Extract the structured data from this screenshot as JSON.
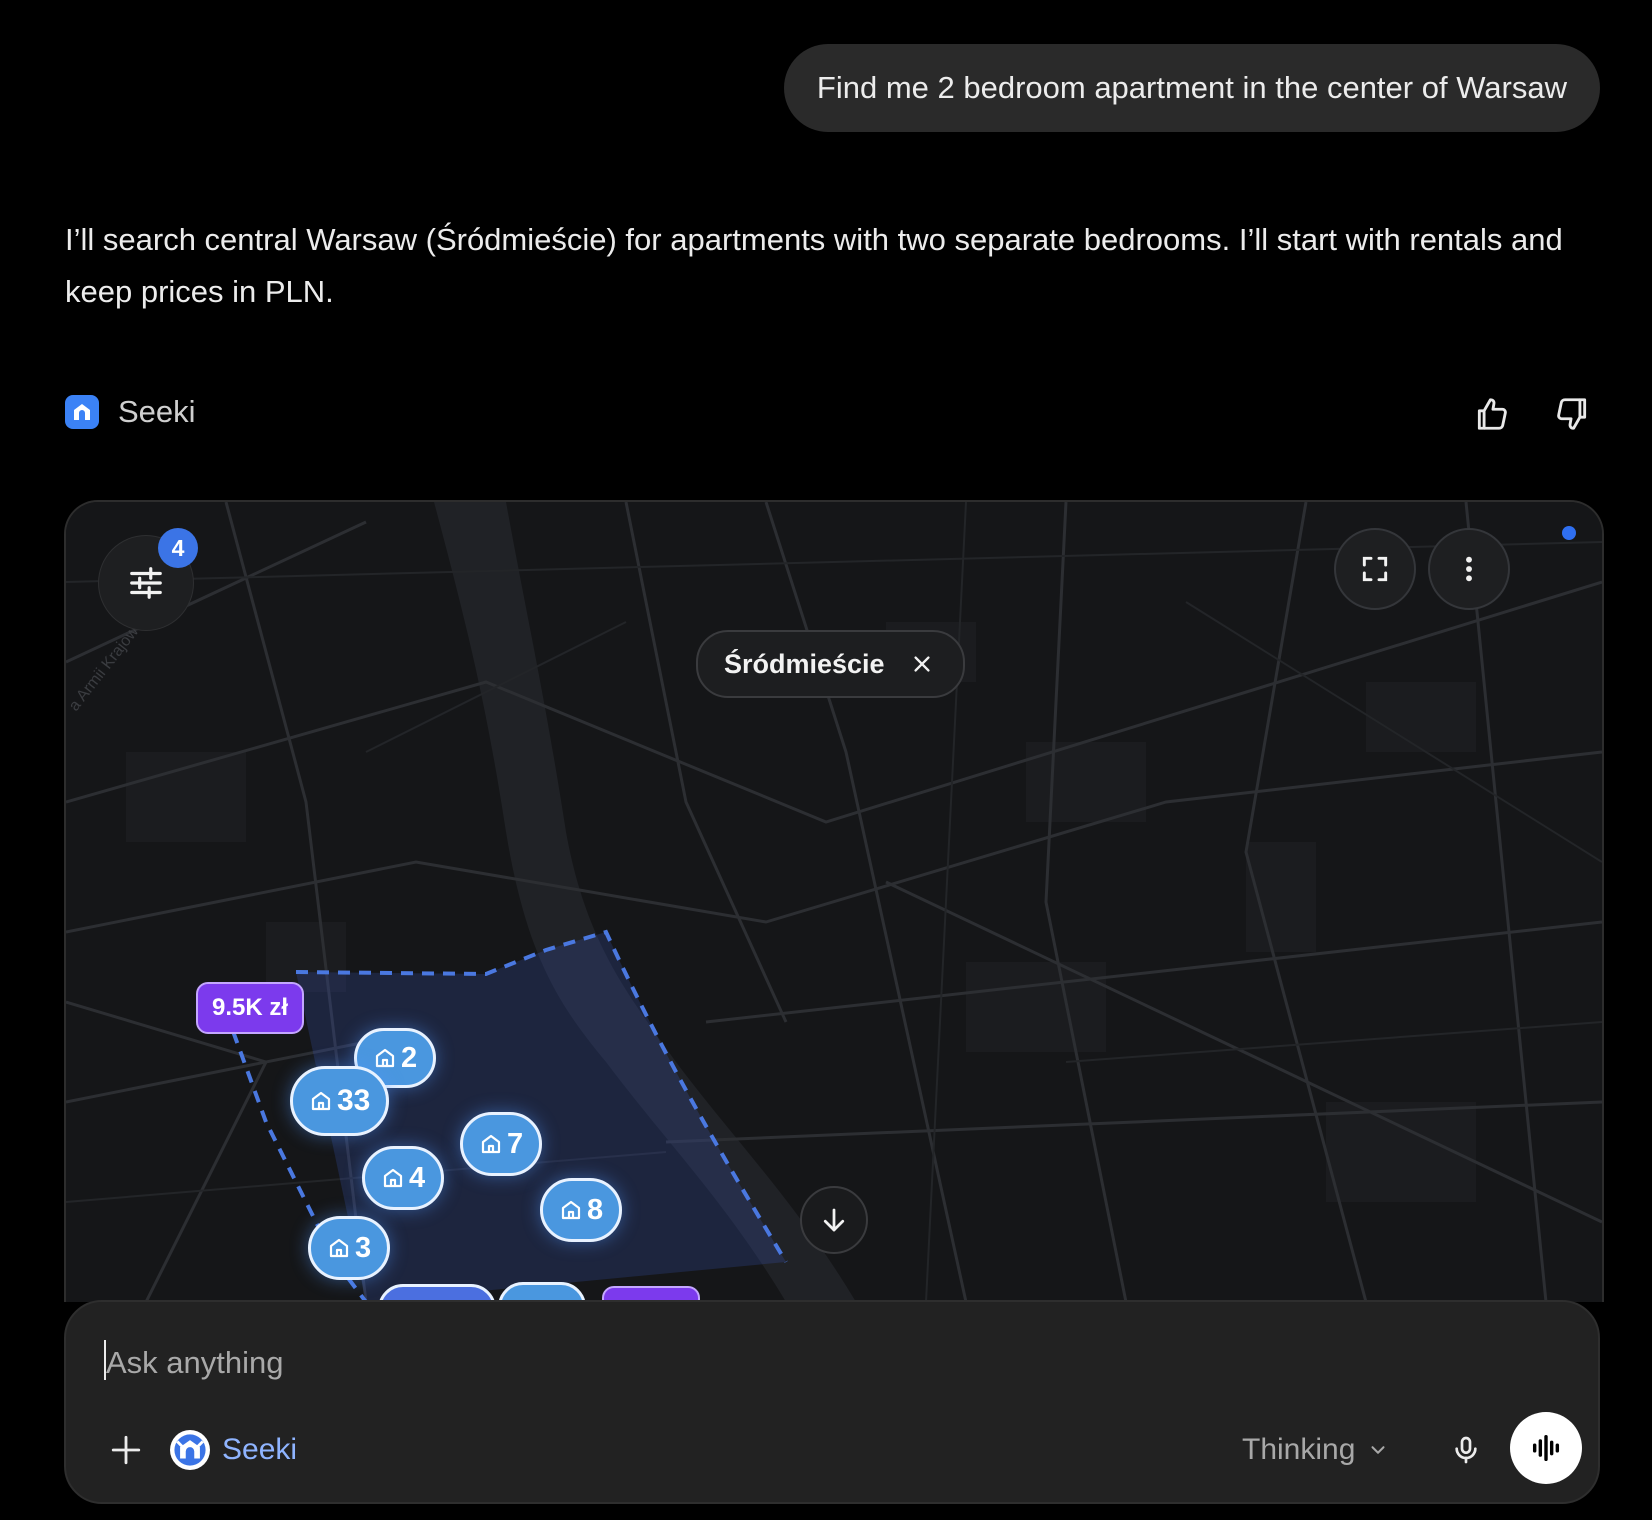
{
  "user_message": "Find me 2 bedroom apartment in the center of Warsaw",
  "assistant": {
    "text": "I’ll search central Warsaw (Śródmieście) for apartments with two separate bedrooms. I’ll start with rentals and keep prices in PLN.",
    "source_name": "Seeki"
  },
  "map": {
    "filter_count": "4",
    "district_chip": "Śródmieście",
    "street_label": "a Armii Krajowej",
    "price_pin": "9.5K zł",
    "clusters": [
      {
        "count": "2"
      },
      {
        "count": "33"
      },
      {
        "count": "7"
      },
      {
        "count": "4"
      },
      {
        "count": "8"
      },
      {
        "count": "3"
      }
    ]
  },
  "composer": {
    "placeholder": "Ask anything",
    "agent_name": "Seeki",
    "mode": "Thinking"
  },
  "colors": {
    "accent": "#3b74e6",
    "cluster": "#4a97df",
    "price_pin": "#7c3aed",
    "background": "#000000"
  }
}
